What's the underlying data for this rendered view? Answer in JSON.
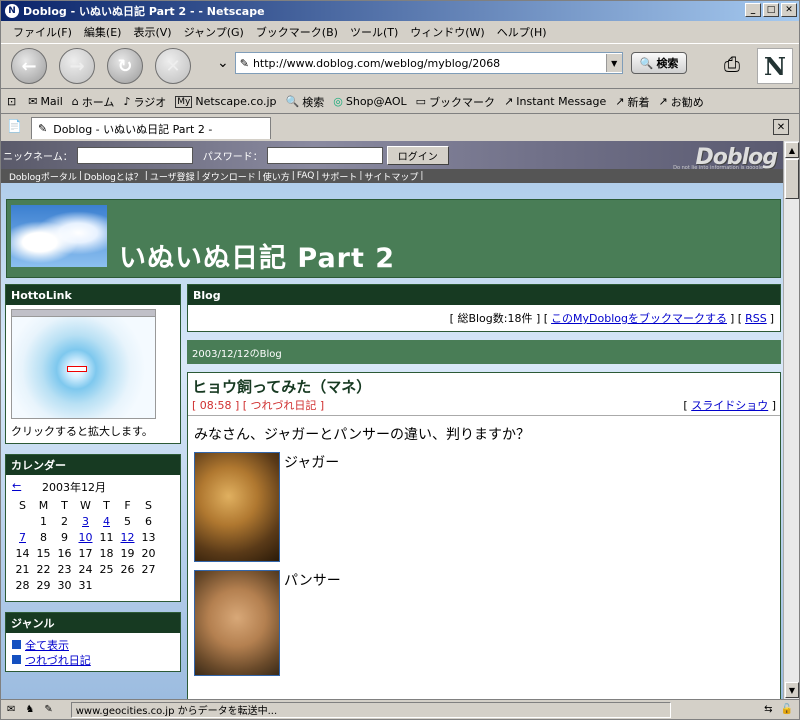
{
  "window": {
    "title": "Doblog - いぬいぬ日記 Part 2 - - Netscape"
  },
  "menu": [
    "ファイル(F)",
    "編集(E)",
    "表示(V)",
    "ジャンプ(G)",
    "ブックマーク(B)",
    "ツール(T)",
    "ウィンドウ(W)",
    "ヘルプ(H)"
  ],
  "nav": {
    "url": "http://www.doblog.com/weblog/myblog/2068",
    "search_label": "検索"
  },
  "personal_toolbar": [
    {
      "icon": "mail-icon",
      "glyph": "✉",
      "label": "Mail"
    },
    {
      "icon": "home-icon",
      "glyph": "⌂",
      "label": "ホーム"
    },
    {
      "icon": "radio-icon",
      "glyph": "♪",
      "label": "ラジオ"
    },
    {
      "icon": "my-icon",
      "glyph": "My",
      "label": "Netscape.co.jp"
    },
    {
      "icon": "search-icon",
      "glyph": "🔍",
      "label": "検索"
    },
    {
      "icon": "aol-icon",
      "glyph": "◎",
      "label": "Shop@AOL"
    },
    {
      "icon": "folder-icon",
      "glyph": "▭",
      "label": "ブックマーク"
    },
    {
      "icon": "link-icon",
      "glyph": "↗",
      "label": "Instant Message"
    },
    {
      "icon": "link-icon",
      "glyph": "↗",
      "label": "新着"
    },
    {
      "icon": "link-icon",
      "glyph": "↗",
      "label": "お勧め"
    }
  ],
  "tab": {
    "label": "Doblog - いぬいぬ日記 Part 2 -"
  },
  "login": {
    "nickname_label": "ニックネーム：",
    "password_label": "パスワード：",
    "button": "ログイン",
    "logo": "Doblog",
    "logo_sub": "Do not lie into information is google"
  },
  "sitemenu": [
    "Doblogポータル",
    "Doblogとは？",
    "ユーザ登録",
    "ダウンロード",
    "使い方",
    "FAQ",
    "サポート",
    "サイトマップ"
  ],
  "banner": {
    "title": "いぬいぬ日記 Part 2"
  },
  "hottolink": {
    "title": "HottoLink",
    "caption": "クリックすると拡大します。"
  },
  "calendar": {
    "title": "カレンダー",
    "prev": "←",
    "month": "2003年12月",
    "weekdays": [
      "S",
      "M",
      "T",
      "W",
      "T",
      "F",
      "S"
    ],
    "weeks": [
      [
        "",
        "1",
        "2",
        "3",
        "4",
        "5",
        "6"
      ],
      [
        "7",
        "8",
        "9",
        "10",
        "11",
        "12",
        "13"
      ],
      [
        "14",
        "15",
        "16",
        "17",
        "18",
        "19",
        "20"
      ],
      [
        "21",
        "22",
        "23",
        "24",
        "25",
        "26",
        "27"
      ],
      [
        "28",
        "29",
        "30",
        "31",
        "",
        "",
        ""
      ]
    ],
    "linked_days": [
      "3",
      "4",
      "7",
      "10",
      "12"
    ]
  },
  "genre": {
    "title": "ジャンル",
    "items": [
      "全て表示",
      "つれづれ日記"
    ]
  },
  "blog": {
    "title": "Blog",
    "info_prefix": "[ 総Blog数:18件 ] [",
    "bookmark_link": "このMyDoblogをブックマークする",
    "info_mid": "] [",
    "rss": "RSS",
    "info_suffix": "]",
    "date": "2003/12/12のBlog"
  },
  "entry": {
    "title": "ヒョウ飼ってみた（マネ）",
    "meta": "[ 08:58 ] [ つれづれ日記 ]",
    "slide_prefix": "[",
    "slide_link": "スライドショウ",
    "slide_suffix": "]",
    "body": "みなさん、ジャガーとパンサーの違い、判りますか？",
    "pic1_label": "ジャガー",
    "pic2_label": "パンサー"
  },
  "status": {
    "text": "www.geocities.co.jp からデータを転送中..."
  }
}
